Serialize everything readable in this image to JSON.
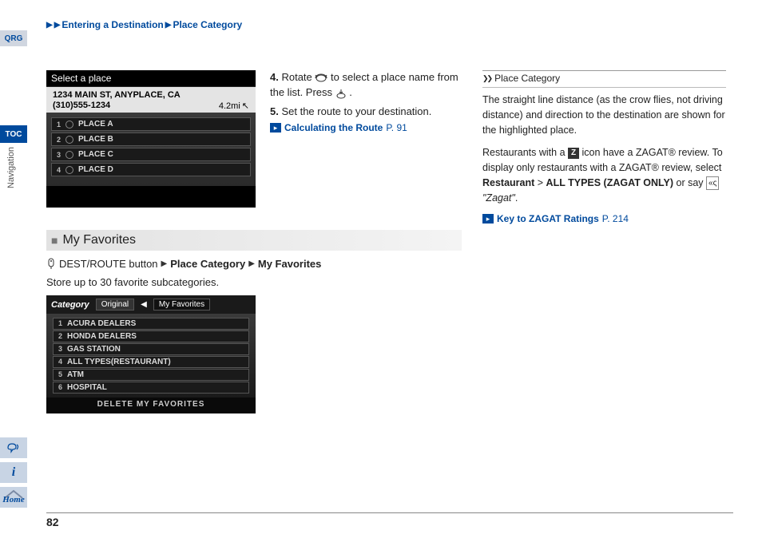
{
  "breadcrumb": {
    "seg1": "Entering a Destination",
    "seg2": "Place Category"
  },
  "sidebar": {
    "qrg": "QRG",
    "toc": "TOC",
    "nav": "Navigation",
    "home": "Home"
  },
  "page_number": "82",
  "screen1": {
    "title": "Select a place",
    "addr1": "1234 MAIN ST, ANYPLACE, CA",
    "addr2": "(310)555-1234",
    "distance": "4.2mi",
    "rows": [
      "PLACE A",
      "PLACE B",
      "PLACE C",
      "PLACE D"
    ]
  },
  "steps": {
    "s4_num": "4.",
    "s4_a": "Rotate ",
    "s4_b": " to select a place name from the list. Press ",
    "s4_c": ".",
    "s5_num": "5.",
    "s5": "Set the route to your destination.",
    "link1_text": "Calculating the Route",
    "link1_page": "P. 91"
  },
  "section": {
    "title": "My Favorites",
    "path_prefix": "DEST/ROUTE button",
    "path_a": "Place Category",
    "path_b": "My Favorites",
    "store": "Store up to 30 favorite subcategories."
  },
  "screen2": {
    "category_label": "Category",
    "tab_original": "Original",
    "tab_fav": "My Favorites",
    "rows": [
      "ACURA DEALERS",
      "HONDA DEALERS",
      "GAS STATION",
      "ALL TYPES(RESTAURANT)",
      "ATM",
      "HOSPITAL"
    ],
    "footer": "DELETE MY FAVORITES"
  },
  "right": {
    "title": "Place Category",
    "p1": "The straight line distance (as the crow flies, not driving distance) and direction to the destination are shown for the highlighted place.",
    "p2a": "Restaurants with a ",
    "p2b": " icon have a ZAGAT® review. To display only restaurants with a ZAGAT® review, select ",
    "p2c": "Restaurant",
    "p2d": " > ",
    "p2e": "ALL TYPES (ZAGAT ONLY)",
    "p2f": " or say ",
    "p2g": "\"Zagat\"",
    "p2h": ".",
    "z": "Z",
    "link2_text": "Key to ZAGAT Ratings",
    "link2_page": "P. 214"
  }
}
